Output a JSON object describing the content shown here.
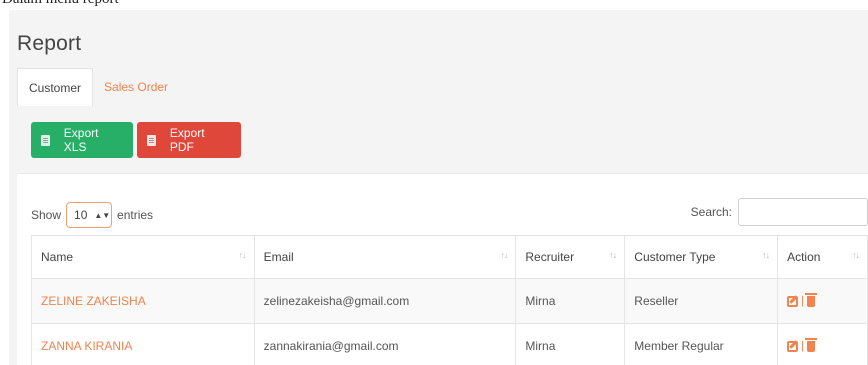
{
  "caption": "Dalam menu report",
  "page": {
    "title": "Report"
  },
  "tabs": [
    {
      "label": "Customer",
      "active": true
    },
    {
      "label": "Sales Order",
      "active": false
    }
  ],
  "toolbar": {
    "export_xls": "Export XLS",
    "export_pdf": "Export PDF",
    "colors": {
      "xls": "#27ae67",
      "pdf": "#e0473b"
    }
  },
  "length_control": {
    "prefix": "Show",
    "value": "10",
    "suffix": "entries"
  },
  "search": {
    "label": "Search:",
    "value": ""
  },
  "table": {
    "columns": [
      "Name",
      "Email",
      "Recruiter",
      "Customer Type",
      "Action"
    ],
    "rows": [
      {
        "name": "ZELINE ZAKEISHA",
        "email": "zelinezakeisha@gmail.com",
        "recruiter": "Mirna",
        "customer_type": "Reseller",
        "action_sep": "|"
      },
      {
        "name": "ZANNA KIRANIA",
        "email": "zannakirania@gmail.com",
        "recruiter": "Mirna",
        "customer_type": "Member Regular",
        "action_sep": "|"
      }
    ]
  },
  "icons": {
    "sort": "sort-arrows-icon",
    "edit": "edit-icon",
    "delete": "trash-icon",
    "file": "file-icon"
  },
  "accent_color": "#f0834e"
}
